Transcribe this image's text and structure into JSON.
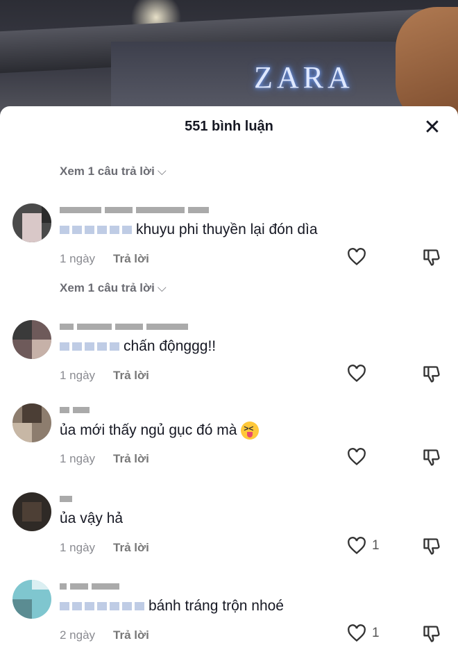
{
  "video": {
    "sign_text": "ZARA"
  },
  "sheet": {
    "title": "551 bình luận"
  },
  "view_replies": {
    "label": "Xem 1 câu trả lời"
  },
  "comments": [
    {
      "text": "khuyu phi thuyền lại đón dìa",
      "time": "1 ngày",
      "reply": "Trả lời",
      "likes": ""
    },
    {
      "text": "chấn độnggg!!",
      "time": "1 ngày",
      "reply": "Trả lời",
      "likes": ""
    },
    {
      "text": "ủa mới thấy ngủ gục đó mà",
      "time": "1 ngày",
      "reply": "Trả lời",
      "likes": "",
      "emoji": "squinting-tongue-emoji"
    },
    {
      "text": "ủa vậy hả",
      "time": "1 ngày",
      "reply": "Trả lời",
      "likes": "1"
    },
    {
      "text": "bánh tráng trộn nhoé",
      "time": "2 ngày",
      "reply": "Trả lời",
      "likes": "1"
    }
  ],
  "icons": {
    "close": "close-icon",
    "like": "heart-icon",
    "dislike": "thumbs-down-icon",
    "chevron": "chevron-down-icon"
  }
}
